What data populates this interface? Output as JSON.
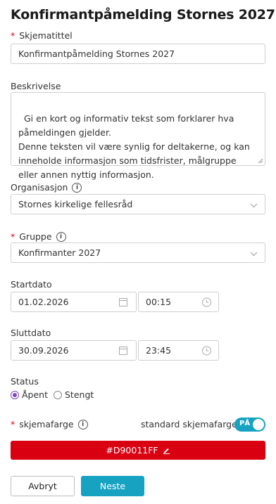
{
  "page": {
    "title": "Konfirmantpåmelding Stornes 2027"
  },
  "form": {
    "title_field": {
      "label": "Skjematittel",
      "required": "*",
      "value": "Konfirmantpåmelding Stornes 2027"
    },
    "description": {
      "label": "Beskrivelse",
      "value": "Gi en kort og informativ tekst som forklarer hva påmeldingen gjelder.\nDenne teksten vil være synlig for deltakerne, og kan inneholde informasjon som tidsfrister, målgruppe eller annen nyttig informasjon."
    },
    "organisation": {
      "label": "Organisasjon",
      "info": "i",
      "value": "Stornes kirkelige fellesråd"
    },
    "group": {
      "label": "Gruppe",
      "required": "*",
      "info": "i",
      "value": "Konfirmanter 2027"
    },
    "start": {
      "label": "Startdato",
      "date": "01.02.2026",
      "time": "00:15"
    },
    "end": {
      "label": "Sluttdato",
      "date": "30.09.2026",
      "time": "23:45"
    },
    "status": {
      "label": "Status",
      "options": [
        "Åpent",
        "Stengt"
      ],
      "selected": "Åpent"
    },
    "color": {
      "label": "skjemafarge",
      "required": "*",
      "info": "i",
      "standard_label": "standard skjemafarge",
      "toggle_text": "PÅ",
      "value": "#D90011FF",
      "swatch": "#d90011"
    }
  },
  "buttons": {
    "cancel": "Avbryt",
    "next": "Neste"
  },
  "colors": {
    "accent": "#17a2c2",
    "radio": "#7b4ab6",
    "required": "#d90011"
  },
  "icons": [
    "info-icon",
    "chevron-down-icon",
    "calendar-icon",
    "clock-icon",
    "pencil-icon"
  ]
}
